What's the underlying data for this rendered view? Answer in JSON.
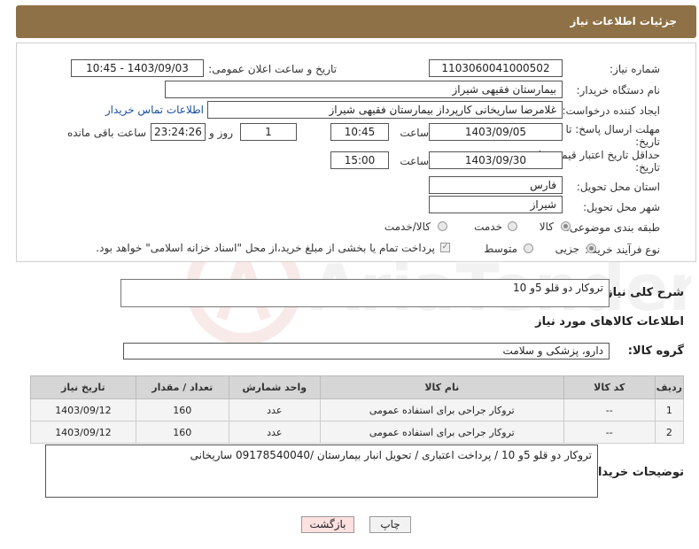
{
  "header": {
    "title": "جزئیات اطلاعات نیاز"
  },
  "form": {
    "need_number": {
      "label": "شماره نیاز:",
      "value": "1103060041000502"
    },
    "announce": {
      "label": "تاریخ و ساعت اعلان عمومی:",
      "value": "1403/09/03 - 10:45"
    },
    "buyer_org": {
      "label": "نام دستگاه خریدار:",
      "value": "بیمارستان فقیهی شیراز"
    },
    "requester": {
      "label": "ایجاد کننده درخواست:",
      "value": "غلامرضا ساریخانی کارپرداز بیمارستان فقیهی شیراز",
      "contact_link": "اطلاعات تماس خریدار"
    },
    "reply_deadline": {
      "label_line1": "مهلت ارسال پاسخ: تا",
      "label_line2": "تاریخ:",
      "date": "1403/09/05",
      "time_label": "ساعت",
      "time": "10:45",
      "days": "1",
      "days_label": "روز و",
      "remaining": "23:24:26",
      "remaining_label": "ساعت باقی مانده"
    },
    "price_validity": {
      "label_line1": "حداقل تاریخ اعتبار قیمت: تا",
      "label_line2": "تاریخ:",
      "date": "1403/09/30",
      "time_label": "ساعت",
      "time": "15:00"
    },
    "province": {
      "label": "استان محل تحویل:",
      "value": "فارس"
    },
    "city": {
      "label": "شهر محل تحویل:",
      "value": "شیراز"
    },
    "category": {
      "label": "طبقه بندی موضوعی:",
      "options": [
        "کالا",
        "خدمت",
        "کالا/خدمت"
      ],
      "selected": "کالا"
    },
    "process": {
      "label": "نوع فرآیند خرید :",
      "options": [
        "جزیی",
        "متوسط"
      ],
      "selected": "جزیی",
      "note": "پرداخت تمام یا بخشی از مبلغ خرید،از محل \"اسناد خزانه اسلامی\" خواهد بود."
    }
  },
  "summary": {
    "label": "شرح کلی نیاز:",
    "value": "تروکار دو قلو 5و 10"
  },
  "goods_title": "اطلاعات کالاهای مورد نیاز",
  "goods_group": {
    "label": "گروه کالا:",
    "value": "دارو، پزشکی و سلامت"
  },
  "table": {
    "headers": [
      "ردیف",
      "کد کالا",
      "نام کالا",
      "واحد شمارش",
      "تعداد / مقدار",
      "تاریخ نیاز"
    ],
    "rows": [
      [
        "1",
        "--",
        "تروکار جراحی برای استفاده عمومی",
        "عدد",
        "160",
        "1403/09/12"
      ],
      [
        "2",
        "--",
        "تروکار جراحی برای استفاده عمومی",
        "عدد",
        "160",
        "1403/09/12"
      ]
    ]
  },
  "buyer_notes": {
    "label": "توضیحات خریدار:",
    "value": "تروکار دو قلو 5و 10 / پرداخت اعتباری / تحویل انبار بیمارستان /09178540040 ساریخانی"
  },
  "buttons": {
    "print": "چاپ",
    "back": "بازگشت"
  },
  "watermark": "AriaTender.neT",
  "colors": {
    "header_bg": "#8e7146",
    "link": "#1a4fa0",
    "back_button_bg": "#fde0e0"
  }
}
